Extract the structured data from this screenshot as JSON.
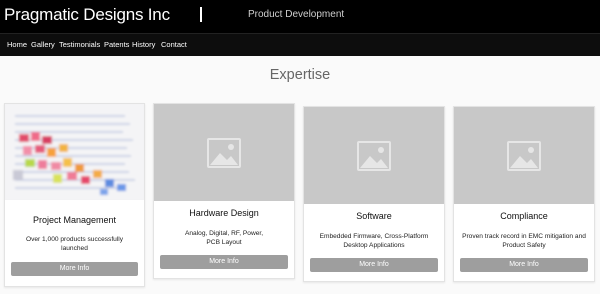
{
  "header": {
    "brand": "Pragmatic Designs Inc",
    "tagline": "Product Development"
  },
  "nav": {
    "items": [
      "Home",
      "Gallery",
      "Testimonials",
      "Patents",
      "History",
      "Contact"
    ]
  },
  "section": {
    "title": "Expertise"
  },
  "cards": [
    {
      "title": "Project Management",
      "desc_line1": "Over 1,000 products successfully",
      "desc_line2": "launched",
      "button": "More Info",
      "image": "project-gantt-chart-photo"
    },
    {
      "title": "Hardware Design",
      "desc_line1": "Analog, Digital, RF, Power,",
      "desc_line2": "PCB Layout",
      "button": "More Info",
      "image": "image-placeholder-icon"
    },
    {
      "title": "Software",
      "desc_line1": "Embedded Firmware, Cross-Platform",
      "desc_line2": "Desktop Applications",
      "button": "More Info",
      "image": "image-placeholder-icon"
    },
    {
      "title": "Compliance",
      "desc_line1": "Proven track record in EMC mitigation and",
      "desc_line2": "Product Safety",
      "button": "More Info",
      "image": "image-placeholder-icon"
    }
  ],
  "colors": {
    "header_bg": "#000000",
    "button_bg": "#9e9e9e",
    "placeholder_bg": "#c8c8c8"
  }
}
